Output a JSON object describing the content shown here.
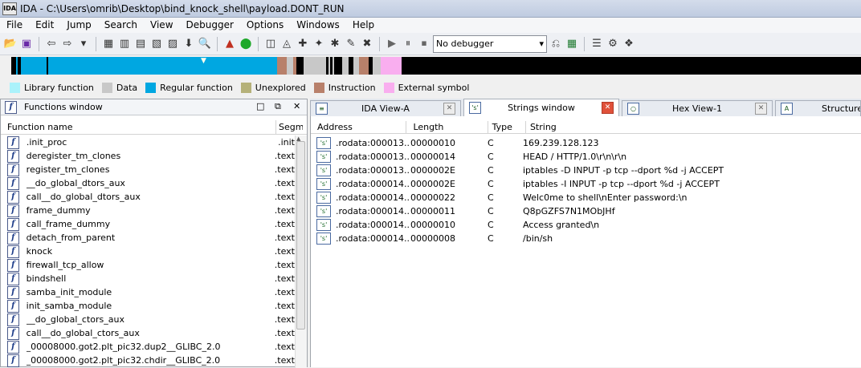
{
  "window": {
    "title": "IDA - C:\\Users\\omrib\\Desktop\\bind_knock_shell\\payload.DONT_RUN",
    "app_icon_text": "IDA"
  },
  "menu": [
    "File",
    "Edit",
    "Jump",
    "Search",
    "View",
    "Debugger",
    "Options",
    "Windows",
    "Help"
  ],
  "toolbar": {
    "debugger_select": "No debugger",
    "icons": [
      "open-icon",
      "save-icon",
      "back-icon",
      "forward-icon",
      "nav-jump-icon",
      "hex-icon",
      "text-icon",
      "data-icon",
      "code-icon",
      "down-icon",
      "search-icon",
      "graph-icon",
      "run-icon",
      "struct-icon",
      "enum-icon",
      "add-icon",
      "func-icon",
      "patch-icon",
      "close-icon",
      "play-icon",
      "pause-icon",
      "stop-icon",
      "attach-icon",
      "dbg-icon",
      "list-icon",
      "tools-icon",
      "plugin-icon"
    ]
  },
  "colors": {
    "library": "#aaf2fb",
    "data": "#c8c8c8",
    "regular": "#00a7e1",
    "unexplored": "#b5b179",
    "instruction": "#b8806a",
    "external": "#f9aeef"
  },
  "legend": [
    {
      "label": "Library function",
      "color": "#aaf2fb"
    },
    {
      "label": "Data",
      "color": "#c8c8c8"
    },
    {
      "label": "Regular function",
      "color": "#00a7e1"
    },
    {
      "label": "Unexplored",
      "color": "#b5b179"
    },
    {
      "label": "Instruction",
      "color": "#b8806a"
    },
    {
      "label": "External symbol",
      "color": "#f9aeef"
    }
  ],
  "functions_window": {
    "title": "Functions window",
    "columns": [
      "Function name",
      "Segment"
    ],
    "rows": [
      {
        "name": ".init_proc",
        "segment": ".init"
      },
      {
        "name": "deregister_tm_clones",
        "segment": ".text"
      },
      {
        "name": "register_tm_clones",
        "segment": ".text"
      },
      {
        "name": "__do_global_dtors_aux",
        "segment": ".text"
      },
      {
        "name": "call__do_global_dtors_aux",
        "segment": ".text"
      },
      {
        "name": "frame_dummy",
        "segment": ".text"
      },
      {
        "name": "call_frame_dummy",
        "segment": ".text"
      },
      {
        "name": "detach_from_parent",
        "segment": ".text"
      },
      {
        "name": "knock",
        "segment": ".text"
      },
      {
        "name": "firewall_tcp_allow",
        "segment": ".text"
      },
      {
        "name": "bindshell",
        "segment": ".text"
      },
      {
        "name": "samba_init_module",
        "segment": ".text"
      },
      {
        "name": "init_samba_module",
        "segment": ".text"
      },
      {
        "name": "__do_global_ctors_aux",
        "segment": ".text"
      },
      {
        "name": "call__do_global_ctors_aux",
        "segment": ".text"
      },
      {
        "name": "_00008000.got2.plt_pic32.dup2__GLIBC_2.0",
        "segment": ".text"
      },
      {
        "name": "_00008000.got2.plt_pic32.chdir__GLIBC_2.0",
        "segment": ".text"
      }
    ]
  },
  "tabs": [
    {
      "label": "IDA View-A",
      "icon": "≡",
      "active": false
    },
    {
      "label": "Strings window",
      "icon": "'s'",
      "active": true
    },
    {
      "label": "Hex View-1",
      "icon": "○",
      "active": false
    },
    {
      "label": "Structures",
      "icon": "A",
      "active": false
    }
  ],
  "strings_window": {
    "columns": [
      "Address",
      "Length",
      "Type",
      "String"
    ],
    "rows": [
      {
        "address": ".rodata:000013...",
        "length": "00000010",
        "type": "C",
        "string": "169.239.128.123"
      },
      {
        "address": ".rodata:000013...",
        "length": "00000014",
        "type": "C",
        "string": "HEAD / HTTP/1.0\\r\\n\\r\\n"
      },
      {
        "address": ".rodata:000013...",
        "length": "0000002E",
        "type": "C",
        "string": "iptables -D INPUT -p tcp --dport %d -j ACCEPT"
      },
      {
        "address": ".rodata:000014...",
        "length": "0000002E",
        "type": "C",
        "string": "iptables -I INPUT -p tcp --dport %d -j ACCEPT"
      },
      {
        "address": ".rodata:000014...",
        "length": "00000022",
        "type": "C",
        "string": "Welc0me to shell\\nEnter password:\\n"
      },
      {
        "address": ".rodata:000014...",
        "length": "00000011",
        "type": "C",
        "string": "Q8pGZFS7N1MObJHf"
      },
      {
        "address": ".rodata:000014...",
        "length": "00000010",
        "type": "C",
        "string": "Access granted\\n"
      },
      {
        "address": ".rodata:000014...",
        "length": "00000008",
        "type": "C",
        "string": "/bin/sh"
      }
    ]
  }
}
